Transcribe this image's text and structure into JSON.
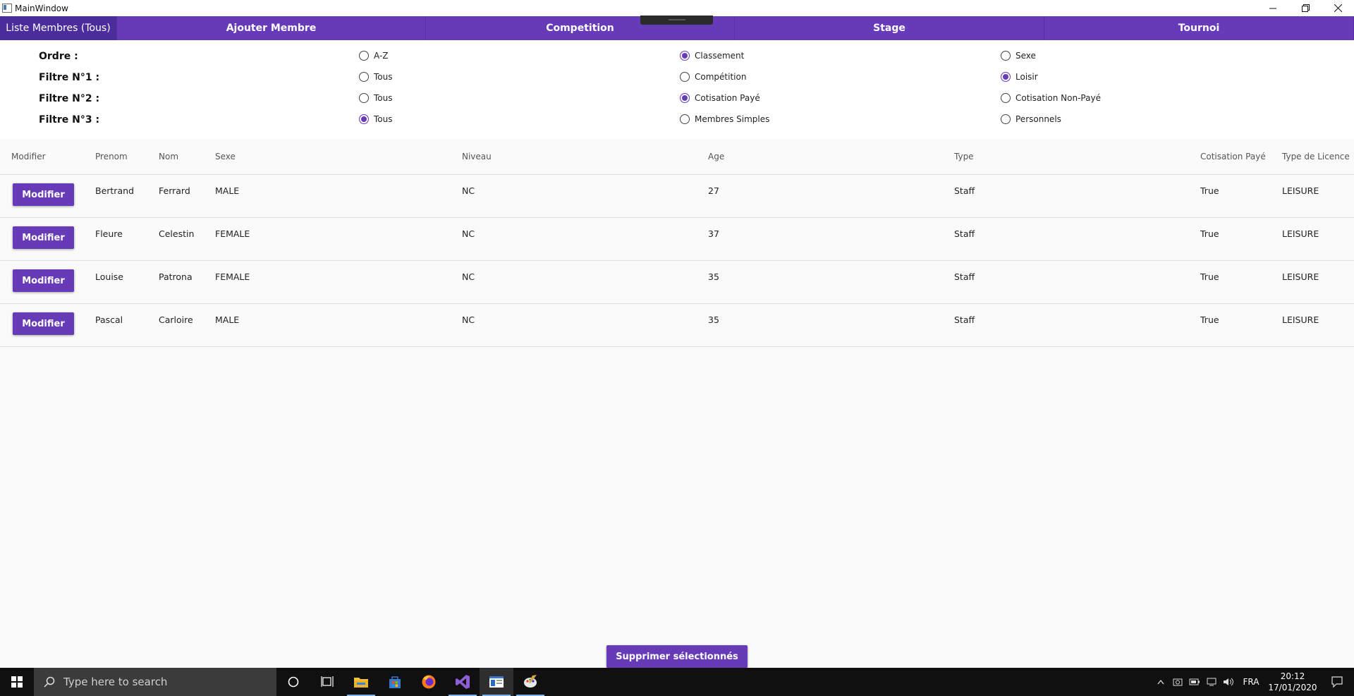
{
  "window": {
    "title": "MainWindow"
  },
  "tabs": [
    {
      "label": "Liste Membres (Tous)",
      "active": true
    },
    {
      "label": "Ajouter Membre",
      "active": false
    },
    {
      "label": "Competition",
      "active": false
    },
    {
      "label": "Stage",
      "active": false
    },
    {
      "label": "Tournoi",
      "active": false
    }
  ],
  "filters": {
    "ordre": {
      "label": "Ordre :",
      "options": [
        "A-Z",
        "Classement",
        "Sexe"
      ],
      "selected": "Classement"
    },
    "filtre1": {
      "label": "Filtre N°1 :",
      "options": [
        "Tous",
        "Compétition",
        "Loisir"
      ],
      "selected": "Loisir"
    },
    "filtre2": {
      "label": "Filtre N°2 :",
      "options": [
        "Tous",
        "Cotisation Payé",
        "Cotisation Non-Payé"
      ],
      "selected": "Cotisation Payé"
    },
    "filtre3": {
      "label": "Filtre N°3 :",
      "options": [
        "Tous",
        "Membres Simples",
        "Personnels"
      ],
      "selected": "Tous"
    }
  },
  "table": {
    "headers": {
      "modifier": "Modifier",
      "prenom": "Prenom",
      "nom": "Nom",
      "sexe": "Sexe",
      "niveau": "Niveau",
      "age": "Age",
      "type": "Type",
      "cotisation": "Cotisation Payé",
      "licence": "Type de Licence"
    },
    "button_label": "Modifier",
    "rows": [
      {
        "prenom": "Bertrand",
        "nom": "Ferrard",
        "sexe": "MALE",
        "niveau": "NC",
        "age": "27",
        "type": "Staff",
        "cotisation": "True",
        "licence": "LEISURE"
      },
      {
        "prenom": "Fleure",
        "nom": "Celestin",
        "sexe": "FEMALE",
        "niveau": "NC",
        "age": "37",
        "type": "Staff",
        "cotisation": "True",
        "licence": "LEISURE"
      },
      {
        "prenom": "Louise",
        "nom": "Patrona",
        "sexe": "FEMALE",
        "niveau": "NC",
        "age": "35",
        "type": "Staff",
        "cotisation": "True",
        "licence": "LEISURE"
      },
      {
        "prenom": "Pascal",
        "nom": "Carloire",
        "sexe": "MALE",
        "niveau": "NC",
        "age": "35",
        "type": "Staff",
        "cotisation": "True",
        "licence": "LEISURE"
      }
    ]
  },
  "actions": {
    "delete_label": "Supprimer sélectionnés"
  },
  "taskbar": {
    "search_placeholder": "Type here to search",
    "language": "FRA",
    "time": "20:12",
    "date": "17/01/2020"
  },
  "colors": {
    "accent": "#673ab7",
    "accent_dark": "#4a2d9a"
  }
}
